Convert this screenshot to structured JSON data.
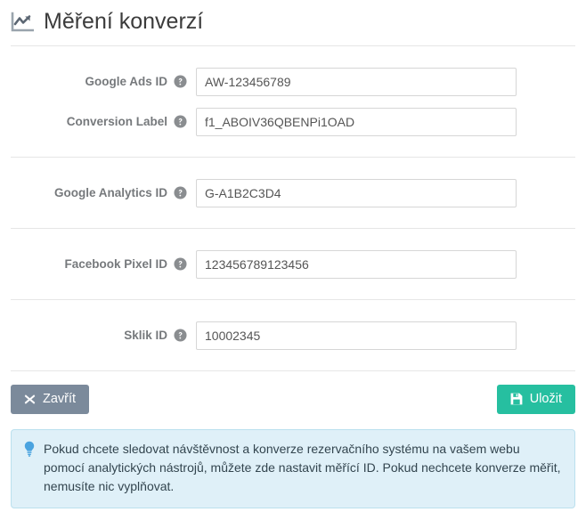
{
  "header": {
    "title": "Měření konverzí",
    "icon": "chart-line-icon"
  },
  "form": {
    "groups": [
      {
        "fields": [
          {
            "label": "Google Ads ID",
            "help_icon": "question-circle-icon",
            "value": "AW-123456789",
            "placeholder": ""
          },
          {
            "label": "Conversion Label",
            "help_icon": "question-circle-icon",
            "value": "f1_ABOIV36QBENPi1OAD",
            "placeholder": ""
          }
        ]
      },
      {
        "fields": [
          {
            "label": "Google Analytics ID",
            "help_icon": "question-circle-icon",
            "value": "G-A1B2C3D4",
            "placeholder": ""
          }
        ]
      },
      {
        "fields": [
          {
            "label": "Facebook Pixel ID",
            "help_icon": "question-circle-icon",
            "value": "123456789123456",
            "placeholder": ""
          }
        ]
      },
      {
        "fields": [
          {
            "label": "Sklik ID",
            "help_icon": "question-circle-icon",
            "value": "10002345",
            "placeholder": ""
          }
        ]
      }
    ]
  },
  "footer": {
    "close_label": "Zavřít",
    "close_icon": "times-icon",
    "save_label": "Uložit",
    "save_icon": "floppy-disk-icon"
  },
  "alert": {
    "icon": "lightbulb-icon",
    "text": "Pokud chcete sledovat návštěvnost a konverze rezervačního systému na vašem webu pomocí analytických nástrojů, můžete zde nastavit měřící ID. Pokud nechcete konverze měřit, nemusíte nic vyplňovat."
  },
  "colors": {
    "save_button": "#26bfa0",
    "close_button": "#7b8a9b",
    "alert_background": "#dff0f8",
    "alert_border": "#bbe0ee",
    "label_text": "#76797c",
    "divider": "#e6e6e6",
    "help_icon": "#8a8d90",
    "bulb_icon": "#4aa3df"
  }
}
